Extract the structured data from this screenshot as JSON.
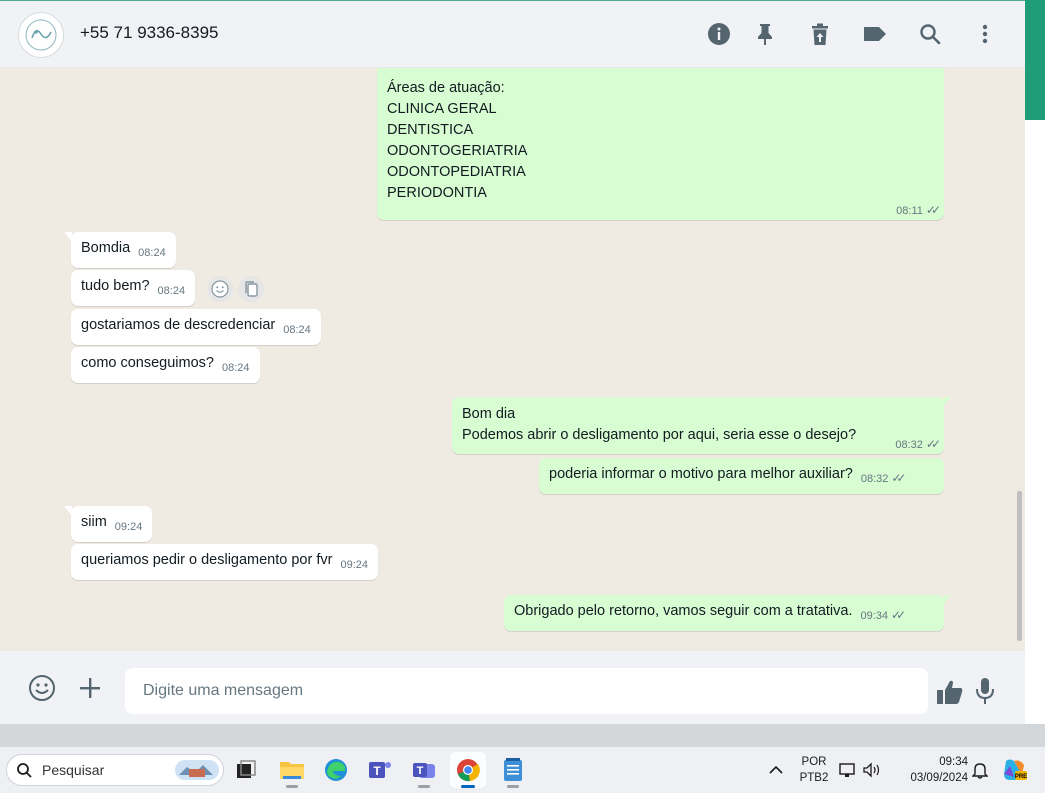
{
  "header": {
    "contact": "+55 71 9336-8395",
    "icons": [
      "info-icon",
      "pin-icon",
      "delete-icon",
      "label-icon",
      "search-icon",
      "more-options-icon"
    ]
  },
  "messages": {
    "m0": {
      "lines": [
        "Áreas de atuação:",
        "CLINICA GERAL",
        "DENTISTICA",
        "ODONTOGERIATRIA",
        "ODONTOPEDIATRIA",
        "PERIODONTIA"
      ],
      "time": "08:11"
    },
    "m1": {
      "text": "Bomdia",
      "time": "08:24"
    },
    "m2": {
      "text": "tudo bem?",
      "time": "08:24"
    },
    "m3": {
      "text": "gostariamos de descredenciar",
      "time": "08:24"
    },
    "m4": {
      "text": "como conseguimos?",
      "time": "08:24"
    },
    "m5": {
      "line1": "Bom dia",
      "line2": "Podemos abrir o desligamento por aqui, seria esse o desejo?",
      "time": "08:32"
    },
    "m6": {
      "text": "poderia informar o motivo para melhor auxiliar?",
      "time": "08:32"
    },
    "m7": {
      "text": "siim",
      "time": "09:24"
    },
    "m8": {
      "text": "queriamos pedir o desligamento por fvr",
      "time": "09:24"
    },
    "m9": {
      "text": "Obrigado pelo retorno, vamos seguir com a tratativa.",
      "time": "09:34"
    }
  },
  "composer": {
    "placeholder": "Digite uma mensagem"
  },
  "taskbar": {
    "search_label": "Pesquisar",
    "lang_line1": "POR",
    "lang_line2": "PTB2",
    "clock_time": "09:34",
    "clock_date": "03/09/2024"
  },
  "colors": {
    "outgoing_bubble": "#d9fdd3",
    "incoming_bubble": "#ffffff",
    "chat_bg": "#efeae2",
    "accent": "#1f9c78"
  }
}
